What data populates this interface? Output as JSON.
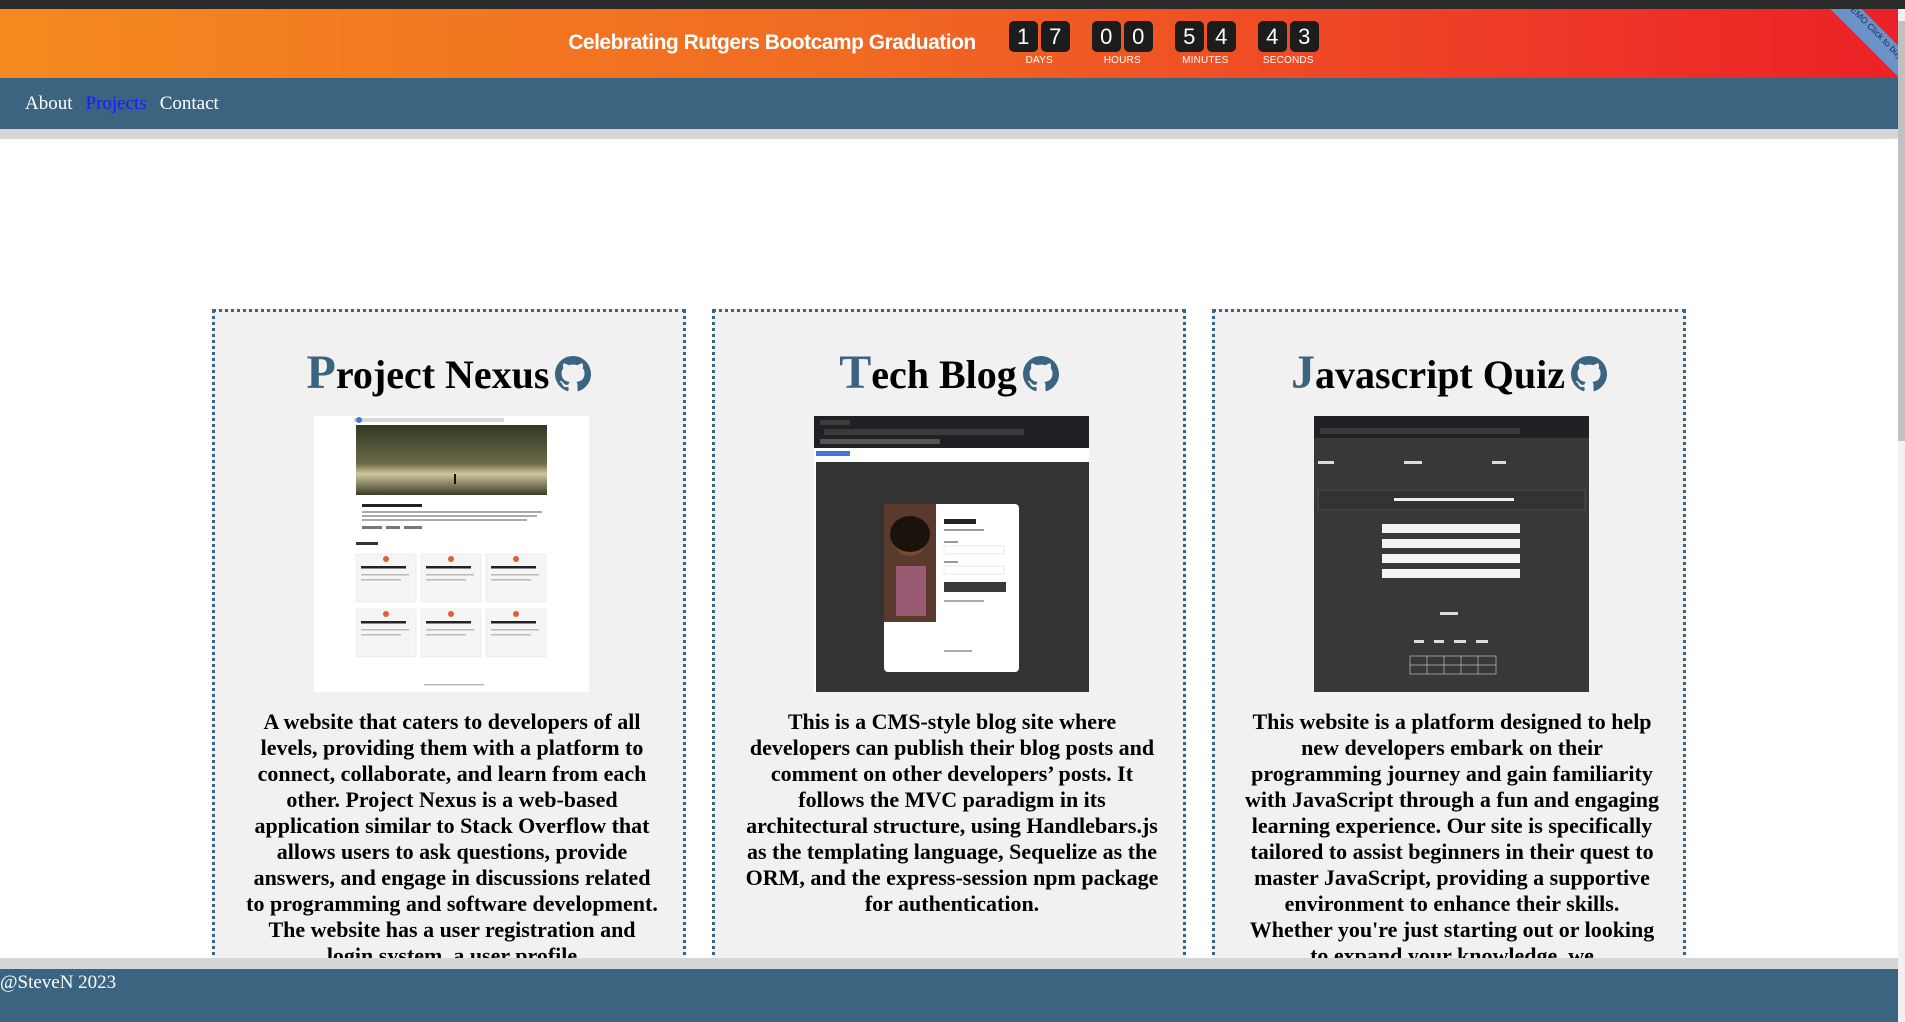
{
  "banner": {
    "title": "Celebrating Rutgers Bootcamp Graduation",
    "countdown": [
      {
        "digits": [
          "1",
          "7"
        ],
        "label": "DAYS"
      },
      {
        "digits": [
          "0",
          "0"
        ],
        "label": "HOURS"
      },
      {
        "digits": [
          "5",
          "4"
        ],
        "label": "MINUTES"
      },
      {
        "digits": [
          "4",
          "3"
        ],
        "label": "SECONDS"
      }
    ],
    "ribbon": "DEMO Click to buy"
  },
  "nav": {
    "items": [
      {
        "label": "About",
        "active": false
      },
      {
        "label": "Projects",
        "active": true
      },
      {
        "label": "Contact",
        "active": false
      }
    ]
  },
  "projects": [
    {
      "title_first": "P",
      "title_rest": "roject Nexus",
      "description": "A website that caters to developers of all levels, providing them with a platform to connect, collaborate, and learn from each other. Project Nexus is a web-based application similar to Stack Overflow that allows users to ask questions, provide answers, and engage in discussions related to programming and software development. The website has a user registration and login system, a user profile"
    },
    {
      "title_first": "T",
      "title_rest": "ech Blog",
      "description": "This is a CMS-style blog site where developers can publish their blog posts and comment on other developers’ posts. It follows the MVC paradigm in its architectural structure, using Handlebars.js as the templating language, Sequelize as the ORM, and the express-session npm package for authentication."
    },
    {
      "title_first": "J",
      "title_rest": "avascript Quiz",
      "description": "This website is a platform designed to help new developers embark on their programming journey and gain familiarity with JavaScript through a fun and engaging learning experience. Our site is specifically tailored to assist beginners in their quest to master JavaScript, providing a supportive environment to enhance their skills. Whether you're just starting out or looking to expand your knowledge, we"
    }
  ],
  "footer": {
    "text": "@SteveN 2023"
  },
  "colors": {
    "accent": "#3a6480",
    "active_link": "#1a1aff",
    "banner_start": "#f5891f",
    "banner_end": "#ec2127"
  }
}
